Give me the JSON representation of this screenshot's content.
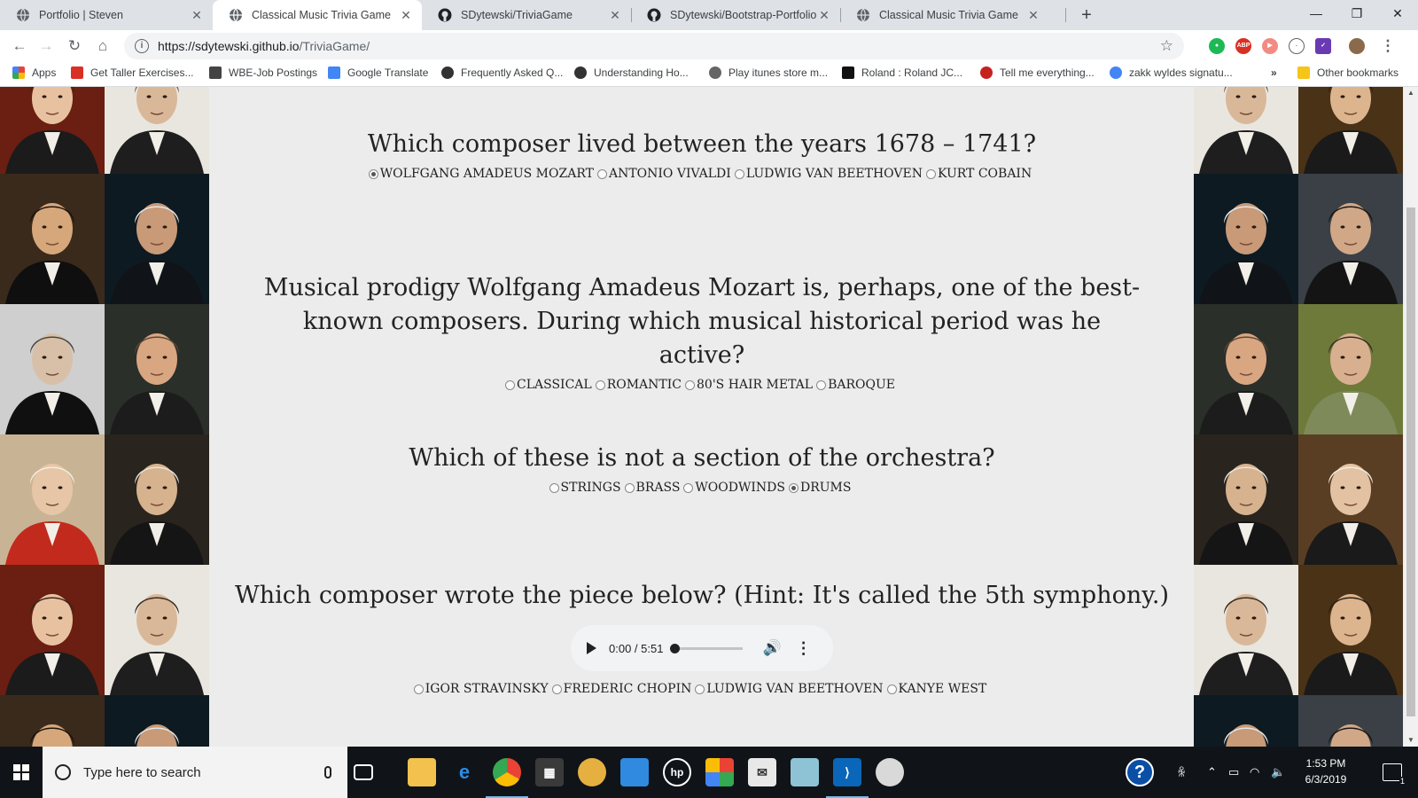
{
  "browser": {
    "tabs": [
      {
        "title": "Portfolio | Steven",
        "active": false,
        "icon": "globe-icon"
      },
      {
        "title": "Classical Music Trivia Game",
        "active": true,
        "icon": "globe-icon"
      },
      {
        "title": "SDytewski/TriviaGame",
        "active": false,
        "icon": "github-icon"
      },
      {
        "title": "SDytewski/Bootstrap-Portfolio",
        "active": false,
        "icon": "github-icon"
      },
      {
        "title": "Classical Music Trivia Game",
        "active": false,
        "icon": "globe-icon"
      }
    ],
    "url_host": "https://sdytewski.github.io",
    "url_path": "/TriviaGame/",
    "bookmarks": [
      {
        "label": "Apps",
        "color": "#ea4335"
      },
      {
        "label": "Get Taller Exercises...",
        "color": "#d93025"
      },
      {
        "label": "WBE-Job Postings",
        "color": "#444444"
      },
      {
        "label": "Google Translate",
        "color": "#4285f4"
      },
      {
        "label": "Frequently Asked Q...",
        "color": "#333333"
      },
      {
        "label": "Understanding Ho...",
        "color": "#333333"
      },
      {
        "label": "Play itunes store m...",
        "color": "#666666"
      },
      {
        "label": "Roland : Roland JC...",
        "color": "#111111"
      },
      {
        "label": "Tell me everything...",
        "color": "#c5221f"
      },
      {
        "label": "zakk wyldes signatu...",
        "color": "#4285f4"
      },
      {
        "label": "Other bookmarks",
        "color": "#f5c518"
      }
    ]
  },
  "questions": [
    {
      "text": "Which composer lived between the years 1678 – 1741?",
      "options": [
        "WOLFGANG AMADEUS MOZART",
        "ANTONIO VIVALDI",
        "LUDWIG VAN BEETHOVEN",
        "KURT COBAIN"
      ],
      "selected": 0
    },
    {
      "text": "Musical prodigy Wolfgang Amadeus Mozart is, perhaps, one of the best-known composers. During which musical historical period was he active?",
      "options": [
        "CLASSICAL",
        "ROMANTIC",
        "80'S HAIR METAL",
        "BAROQUE"
      ],
      "selected": -1
    },
    {
      "text": "Which of these is not a section of the orchestra?",
      "options": [
        "STRINGS",
        "BRASS",
        "WOODWINDS",
        "DRUMS"
      ],
      "selected": 3
    },
    {
      "text": "Which composer wrote the piece below? (Hint: It's called the 5th symphony.)",
      "options": [
        "IGOR STRAVINSKY",
        "FREDERIC CHOPIN",
        "LUDWIG VAN BEETHOVEN",
        "KANYE WEST"
      ],
      "selected": -1
    }
  ],
  "audio": {
    "time": "0:00 / 5:51",
    "progress": 0
  },
  "taskbar": {
    "search_placeholder": "Type here to search",
    "time": "1:53 PM",
    "date": "6/3/2019",
    "notification_count": "1"
  },
  "portrait_palettes": [
    {
      "bg": "#6b1e12",
      "skin": "#e8c2a0",
      "coat": "#1b1b1b",
      "hair": "#3a2418"
    },
    {
      "bg": "#e9e6df",
      "skin": "#d9b89a",
      "coat": "#1e1e1e",
      "hair": "#6e5640"
    },
    {
      "bg": "#3a2a1c",
      "skin": "#d6a77a",
      "coat": "#0f0f0f",
      "hair": "#1a120c"
    },
    {
      "bg": "#0e1a22",
      "skin": "#c89a78",
      "coat": "#101418",
      "hair": "#e6e6e6"
    },
    {
      "bg": "#cfcfcf",
      "skin": "#d8c0a8",
      "coat": "#101010",
      "hair": "#444444"
    },
    {
      "bg": "#2a2f2a",
      "skin": "#d9a682",
      "coat": "#1c1c1c",
      "hair": "#5a4634"
    },
    {
      "bg": "#c8b494",
      "skin": "#e6c6a6",
      "coat": "#c22a1e",
      "hair": "#f1ede4"
    },
    {
      "bg": "#2a241e",
      "skin": "#d6b28e",
      "coat": "#151515",
      "hair": "#e8e4dc"
    },
    {
      "bg": "#6b1e12",
      "skin": "#e8c2a0",
      "coat": "#1b1b1b",
      "hair": "#3a2418"
    },
    {
      "bg": "#e9e6df",
      "skin": "#d9b89a",
      "coat": "#1e1e1e",
      "hair": "#3b2a1c"
    },
    {
      "bg": "#3a2a1c",
      "skin": "#d6a77a",
      "coat": "#0f0f0f",
      "hair": "#1a120c"
    },
    {
      "bg": "#0e1a22",
      "skin": "#c89a78",
      "coat": "#101418",
      "hair": "#e6e6e6"
    }
  ],
  "portrait_palettes_right": [
    {
      "bg": "#e9e6df",
      "skin": "#d9b89a",
      "coat": "#1e1e1e",
      "hair": "#6e5640"
    },
    {
      "bg": "#4a3216",
      "skin": "#dcb48e",
      "coat": "#1a1a1a",
      "hair": "#2b1d12"
    },
    {
      "bg": "#0e1a22",
      "skin": "#c89a78",
      "coat": "#101418",
      "hair": "#e6e6e6"
    },
    {
      "bg": "#3a4046",
      "skin": "#d0a888",
      "coat": "#141414",
      "hair": "#1c1410"
    },
    {
      "bg": "#2a2f2a",
      "skin": "#d9a682",
      "coat": "#1c1c1c",
      "hair": "#5a4634"
    },
    {
      "bg": "#6e7a3a",
      "skin": "#d8b090",
      "coat": "#7e8a5a",
      "hair": "#3a2c20"
    },
    {
      "bg": "#2a241e",
      "skin": "#d6b28e",
      "coat": "#151515",
      "hair": "#e8e4dc"
    },
    {
      "bg": "#5a3e24",
      "skin": "#e2c2a2",
      "coat": "#1a1a1a",
      "hair": "#f0ece2"
    },
    {
      "bg": "#e9e6df",
      "skin": "#d9b89a",
      "coat": "#1e1e1e",
      "hair": "#3b2a1c"
    },
    {
      "bg": "#4a3216",
      "skin": "#dcb48e",
      "coat": "#1a1a1a",
      "hair": "#2b1d12"
    },
    {
      "bg": "#0e1a22",
      "skin": "#c89a78",
      "coat": "#101418",
      "hair": "#e6e6e6"
    },
    {
      "bg": "#3a4046",
      "skin": "#d0a888",
      "coat": "#141414",
      "hair": "#1c1410"
    }
  ]
}
